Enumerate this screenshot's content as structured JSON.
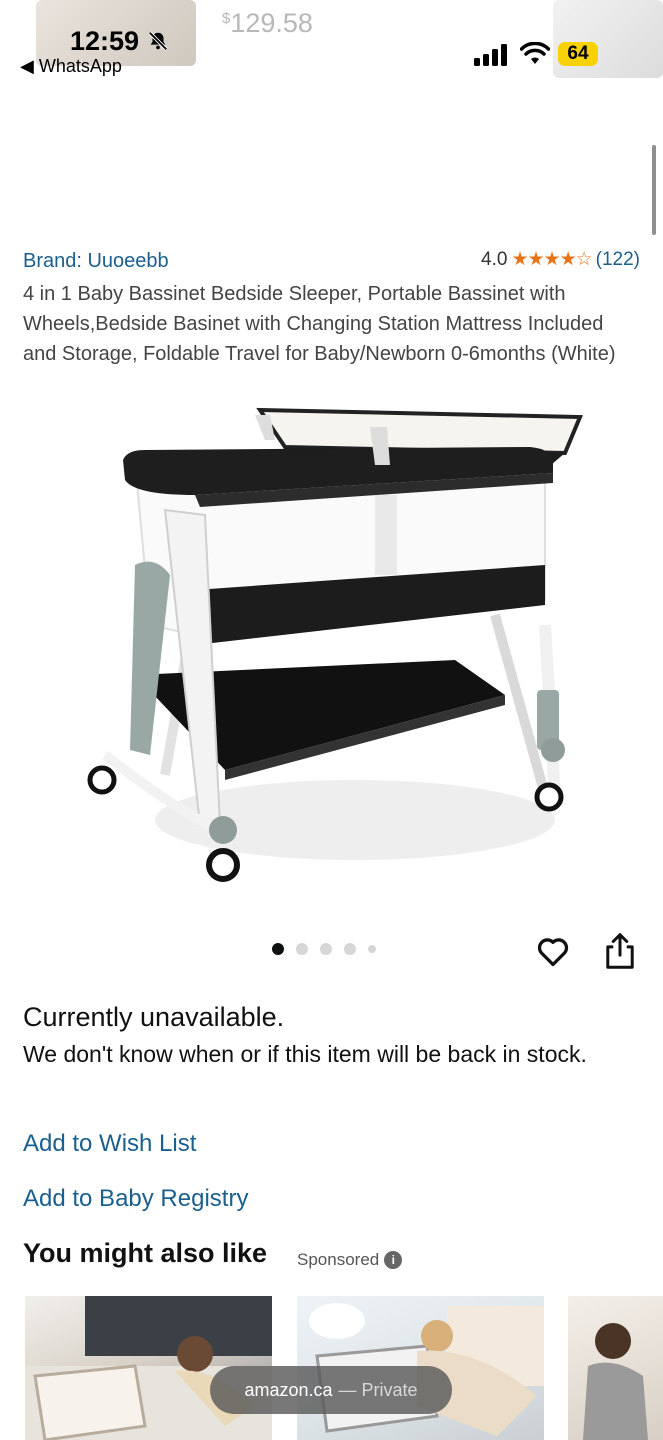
{
  "status_bar": {
    "time": "12:59",
    "back_app": "WhatsApp",
    "battery": "64"
  },
  "top_strip": {
    "price_symbol": "$",
    "price_value": "129.58"
  },
  "product": {
    "brand": "Brand: Uuoeebb",
    "rating_value": "4.0",
    "stars": "★★★★☆",
    "rating_count": "(122)",
    "title": "4 in 1 Baby Bassinet Bedside Sleeper, Portable Bassinet with Wheels,Bedside Basinet with Changing Station Mattress Included and Storage, Foldable Travel for Baby/Newborn 0-6months (White)"
  },
  "gallery": {
    "image_count": 5,
    "active_index": 0
  },
  "availability": {
    "headline": "Currently unavailable.",
    "detail": "We don't know when or if this item will be back in stock."
  },
  "actions": {
    "wish_list": "Add to Wish List",
    "baby_registry": "Add to Baby Registry"
  },
  "recommendations": {
    "heading": "You might also like",
    "sponsored_label": "Sponsored",
    "info_glyph": "i"
  },
  "browser_pill": {
    "domain": "amazon.ca",
    "mode": "— Private"
  },
  "icons": [
    "bell-slash-icon",
    "signal-icon",
    "wifi-icon",
    "heart-icon",
    "share-icon",
    "info-icon"
  ]
}
